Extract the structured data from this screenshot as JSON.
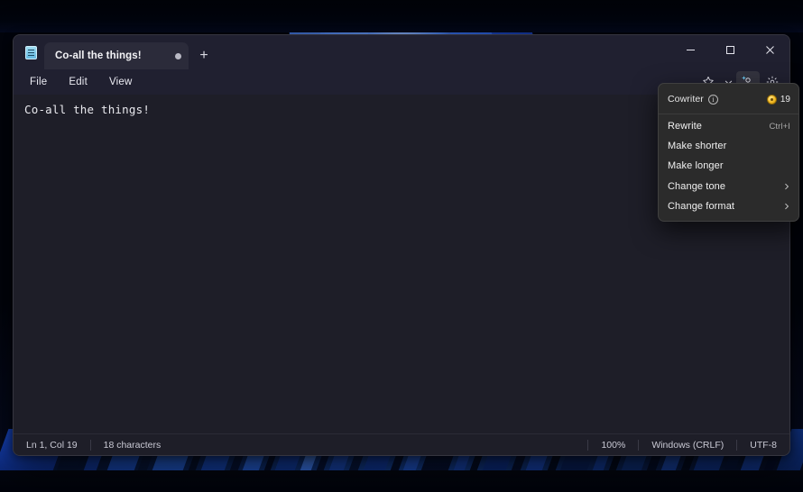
{
  "window": {
    "app_icon": "notepad-document-icon",
    "tab": {
      "title": "Co-all the things!",
      "modified_indicator": "●",
      "new_tab_label": "+"
    },
    "controls": {
      "minimize": "minimize-icon",
      "maximize": "maximize-icon",
      "close": "close-icon"
    }
  },
  "menubar": {
    "items": [
      {
        "label": "File"
      },
      {
        "label": "Edit"
      },
      {
        "label": "View"
      }
    ],
    "toolbar": {
      "star_icon": "star-icon",
      "chevron_icon": "chevron-down-icon",
      "cowriter_icon": "cowriter-ai-icon",
      "settings_icon": "gear-icon"
    }
  },
  "editor": {
    "content": "Co-all the things!"
  },
  "statusbar": {
    "cursor_position": "Ln 1, Col 19",
    "character_count": "18 characters",
    "zoom": "100%",
    "line_ending": "Windows (CRLF)",
    "encoding": "UTF-8"
  },
  "cowriter_menu": {
    "header": {
      "title": "Cowriter",
      "info_icon": "info-icon",
      "info_glyph": "i",
      "credits_icon": "coin-icon",
      "credits": "19"
    },
    "items": [
      {
        "label": "Rewrite",
        "accel": "Ctrl+I",
        "submenu": false
      },
      {
        "label": "Make shorter",
        "accel": "",
        "submenu": false
      },
      {
        "label": "Make longer",
        "accel": "",
        "submenu": false
      },
      {
        "label": "Change tone",
        "accel": "",
        "submenu": true
      },
      {
        "label": "Change format",
        "accel": "",
        "submenu": true
      }
    ]
  },
  "colors": {
    "window_bg": "#202030",
    "editor_bg": "#1e1e28",
    "tab_active": "#2b2b3a",
    "menu_bg": "#2b2b2b",
    "credit_gold": "#f0b51e",
    "accent_blue": "#2f6ff0"
  }
}
